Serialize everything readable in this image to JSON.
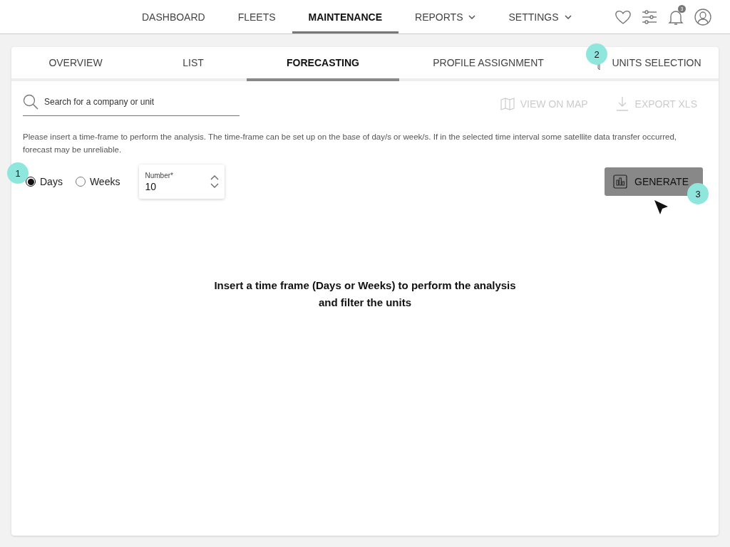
{
  "nav": {
    "items": [
      {
        "label": "DASHBOARD",
        "selected": false,
        "dropdown": false
      },
      {
        "label": "FLEETS",
        "selected": false,
        "dropdown": false
      },
      {
        "label": "MAINTENANCE",
        "selected": true,
        "dropdown": false
      },
      {
        "label": "REPORTS",
        "selected": false,
        "dropdown": true
      },
      {
        "label": "SETTINGS",
        "selected": false,
        "dropdown": true
      }
    ],
    "notification_count": "3"
  },
  "tabs": [
    {
      "label": "OVERVIEW",
      "selected": false,
      "kind": "plain"
    },
    {
      "label": "LIST",
      "selected": false,
      "kind": "plain"
    },
    {
      "label": "FORECASTING",
      "selected": true,
      "kind": "plain"
    },
    {
      "label": "PROFILE ASSIGNMENT",
      "selected": false,
      "kind": "plain"
    },
    {
      "label": "UNITS SELECTION",
      "selected": false,
      "kind": "filter"
    }
  ],
  "search": {
    "placeholder": "Search for a company or unit"
  },
  "actions": [
    {
      "label": "VIEW ON MAP",
      "kind": "map",
      "disabled": true
    },
    {
      "label": "EXPORT XLS",
      "kind": "download",
      "disabled": true
    }
  ],
  "description": "Please insert a time-frame to perform the analysis. The time-frame can be set up on the base of day/s or week/s. If in the selected time interval some satellite data transfer occurred, forecast may be unreliable.",
  "radios": [
    {
      "label": "Days",
      "selected": true
    },
    {
      "label": "Weeks",
      "selected": false
    }
  ],
  "number_field": {
    "label": "Number*",
    "value": "10"
  },
  "generate_button": {
    "label": "GENERATE"
  },
  "empty_message": "Insert a time frame (Days or Weeks) to perform the analysis and filter the units",
  "annotations": [
    "1",
    "2",
    "3"
  ]
}
